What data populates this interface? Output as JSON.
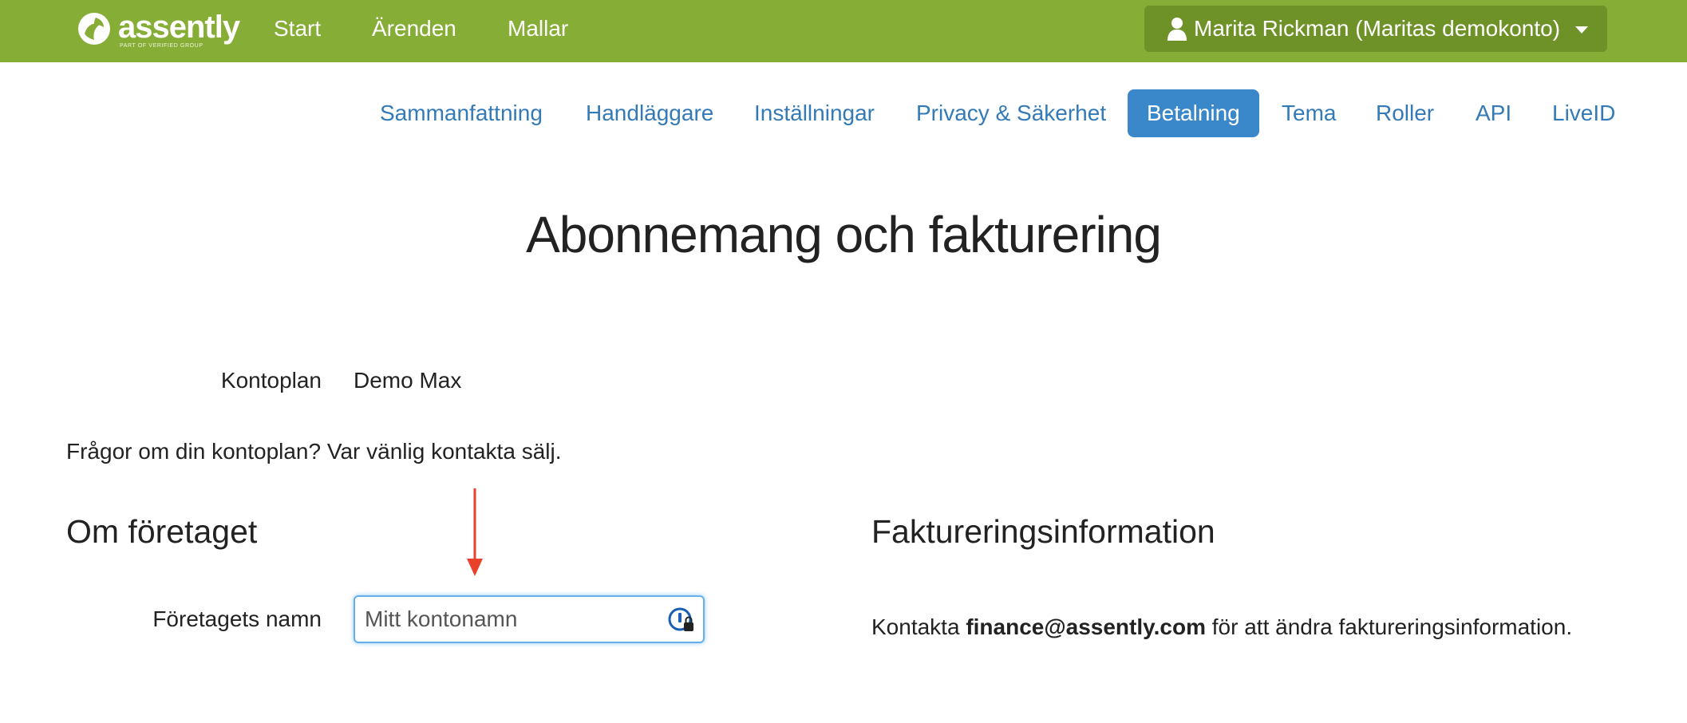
{
  "brand": {
    "name": "assently",
    "tagline": "PART OF VERIFIED GROUP",
    "color": "#86ad35"
  },
  "nav": {
    "items": [
      "Start",
      "Ärenden",
      "Mallar"
    ]
  },
  "user_menu": {
    "label": "Marita Rickman (Maritas demokonto)"
  },
  "tabs": {
    "items": [
      "Sammanfattning",
      "Handläggare",
      "Inställningar",
      "Privacy & Säkerhet",
      "Betalning",
      "Tema",
      "Roller",
      "API",
      "LiveID"
    ],
    "active": "Betalning",
    "active_color": "#3a87c9"
  },
  "page": {
    "title": "Abonnemang och fakturering"
  },
  "plan": {
    "label": "Kontoplan",
    "value": "Demo Max",
    "question": "Frågor om din kontoplan? Var vänlig kontakta sälj."
  },
  "company": {
    "heading": "Om företaget",
    "name_label": "Företagets namn",
    "name_value": "Mitt kontonamn"
  },
  "billing": {
    "heading": "Faktureringsinformation",
    "text_before": "Kontakta ",
    "email": "finance@assently.com",
    "text_after": " för att ändra faktureringsinformation."
  },
  "annotation": {
    "arrow_color": "#e8412c"
  }
}
